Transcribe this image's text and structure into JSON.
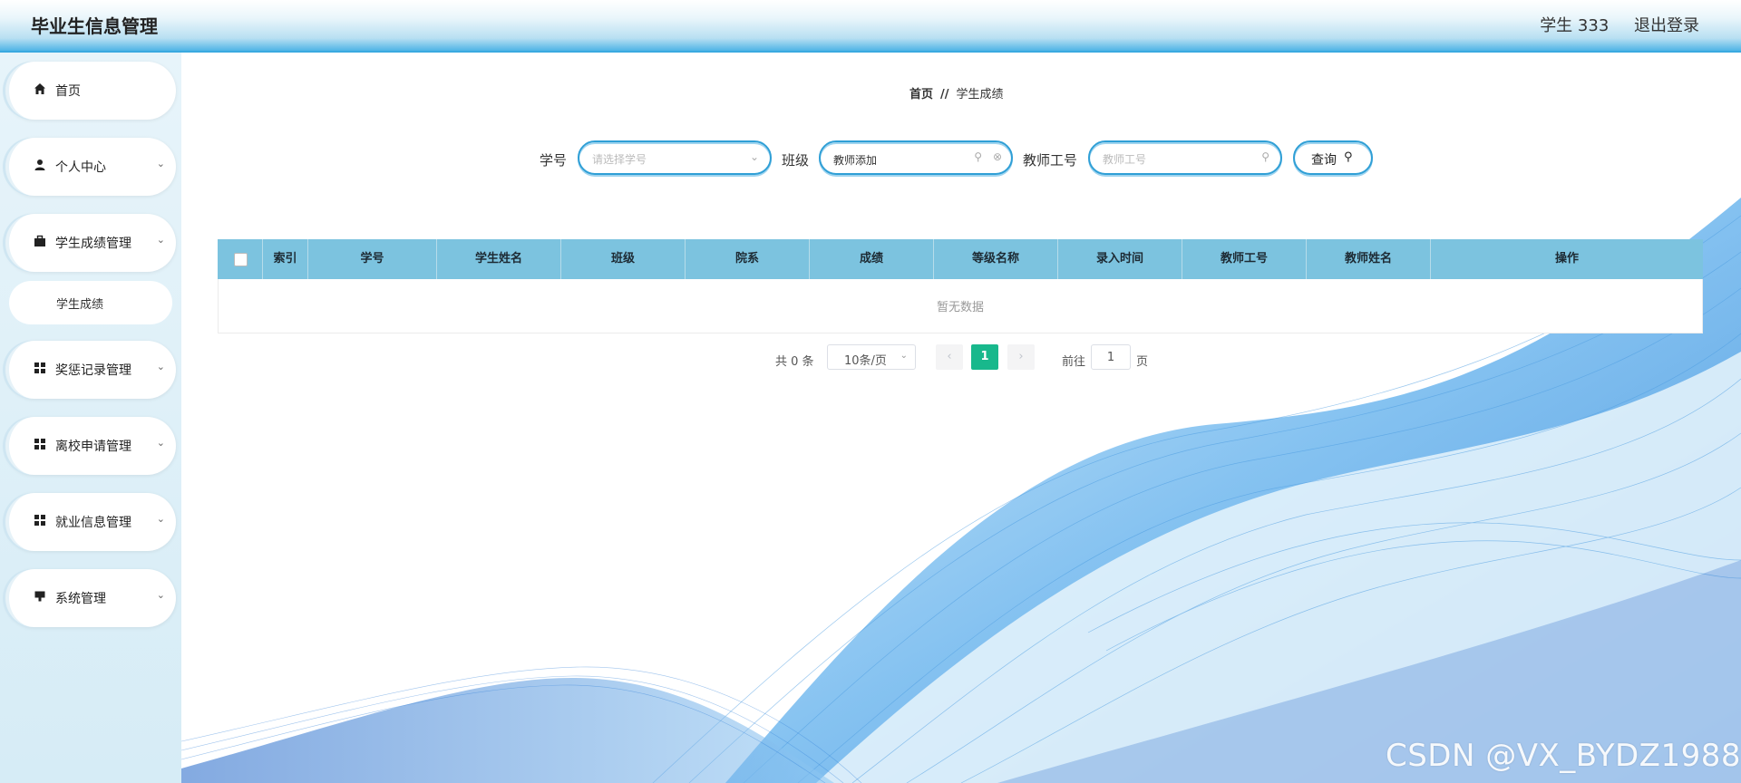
{
  "header": {
    "title": "毕业生信息管理",
    "user": "学生 333",
    "logout": "退出登录"
  },
  "sidebar": {
    "items": [
      {
        "label": "首页",
        "icon": "home-icon"
      },
      {
        "label": "个人中心",
        "icon": "user-icon"
      },
      {
        "label": "学生成绩管理",
        "icon": "briefcase-icon"
      },
      {
        "label": "奖惩记录管理",
        "icon": "grid-icon"
      },
      {
        "label": "离校申请管理",
        "icon": "grid-icon"
      },
      {
        "label": "就业信息管理",
        "icon": "grid-icon"
      },
      {
        "label": "系统管理",
        "icon": "monitor-icon"
      }
    ],
    "sub_item": "学生成绩"
  },
  "breadcrumb": {
    "home": "首页",
    "sep": "//",
    "current": "学生成绩"
  },
  "search": {
    "student_no_label": "学号",
    "student_no_placeholder": "请选择学号",
    "class_label": "班级",
    "class_value": "教师添加",
    "teacher_no_label": "教师工号",
    "teacher_no_placeholder": "教师工号",
    "query_button": "查询"
  },
  "table": {
    "columns": [
      "索引",
      "学号",
      "学生姓名",
      "班级",
      "院系",
      "成绩",
      "等级名称",
      "录入时间",
      "教师工号",
      "教师姓名",
      "操作"
    ],
    "empty_text": "暂无数据"
  },
  "pagination": {
    "total": "共 0 条",
    "page_size": "10条/页",
    "current_page": "1",
    "goto_label": "前往",
    "goto_value": "1",
    "page_suffix": "页"
  },
  "watermark": "CSDN @VX_BYDZ1988",
  "colors": {
    "accent": "#3aa9e0",
    "table_header": "#7cc3df",
    "active_page": "#18b88c"
  }
}
